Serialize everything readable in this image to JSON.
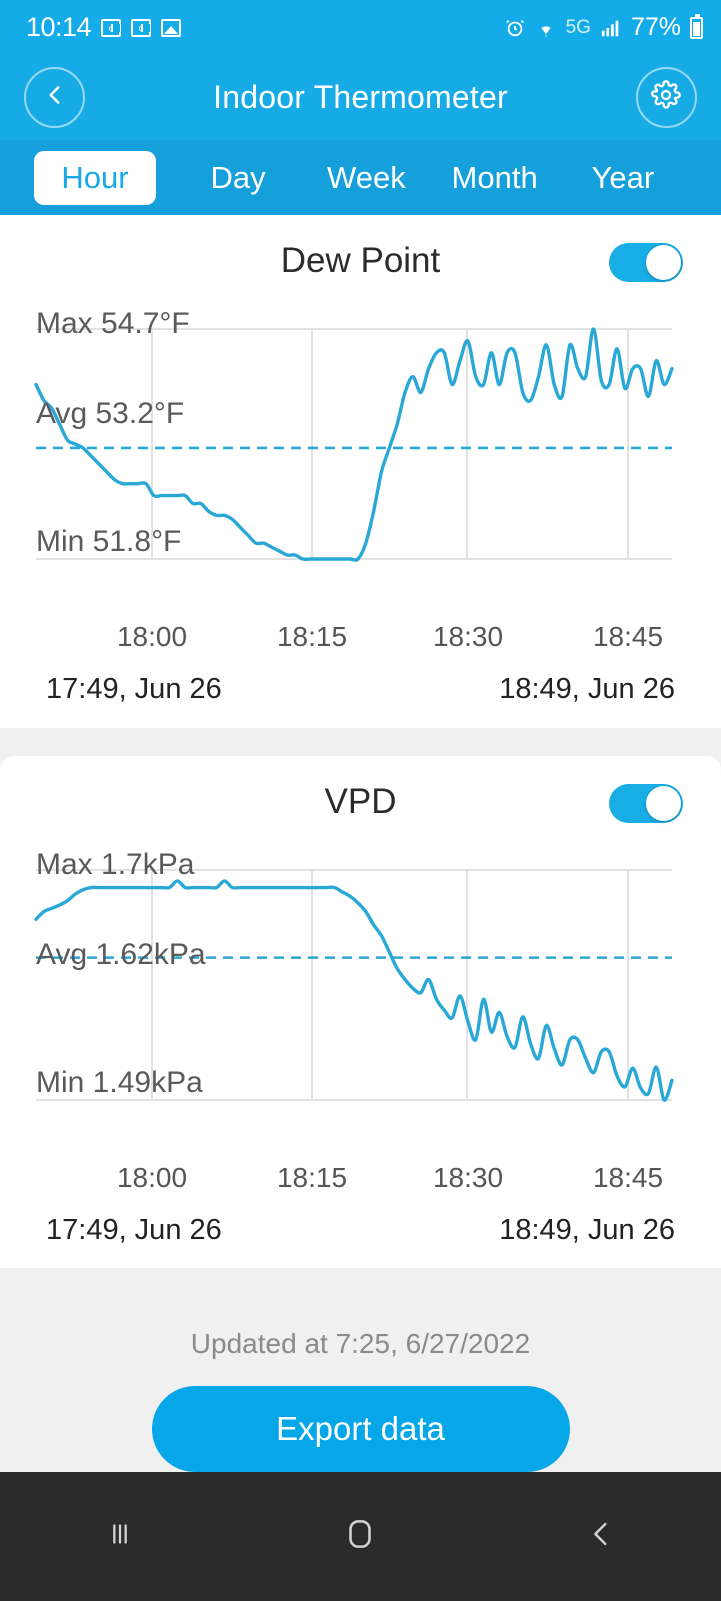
{
  "statusbar": {
    "time": "10:14",
    "network": "5G",
    "battery_pct": "77%",
    "icons": [
      "outlook-badge-icon",
      "outlook-badge-icon",
      "image-icon",
      "alarm-icon",
      "wifi-icon",
      "signal-icon",
      "battery-icon"
    ]
  },
  "appbar": {
    "title": "Indoor Thermometer",
    "back_icon": "chevron-left-icon",
    "settings_icon": "gear-icon"
  },
  "tabs": [
    {
      "label": "Hour",
      "active": true
    },
    {
      "label": "Day",
      "active": false
    },
    {
      "label": "Week",
      "active": false
    },
    {
      "label": "Month",
      "active": false
    },
    {
      "label": "Year",
      "active": false
    }
  ],
  "cards": [
    {
      "title": "Dew Point",
      "toggle_on": true,
      "max_label": "Max 54.7°F",
      "avg_label": "Avg 53.2°F",
      "min_label": "Min 51.8°F",
      "range_start": "17:49,  Jun 26",
      "range_end": "18:49,  Jun 26",
      "xticks": [
        "18:00",
        "18:15",
        "18:30",
        "18:45"
      ]
    },
    {
      "title": "VPD",
      "toggle_on": true,
      "max_label": "Max 1.7kPa",
      "avg_label": "Avg 1.62kPa",
      "min_label": "Min 1.49kPa",
      "range_start": "17:49,  Jun 26",
      "range_end": "18:49,  Jun 26",
      "xticks": [
        "18:00",
        "18:15",
        "18:30",
        "18:45"
      ]
    }
  ],
  "footer": {
    "updated": "Updated at 7:25,  6/27/2022",
    "export_label": "Export data"
  },
  "navbar": {
    "recents_icon": "recents-icon",
    "home_icon": "home-icon",
    "back_icon": "back-icon"
  },
  "colors": {
    "brand": "#17ABE6",
    "tabbar": "#159FDB",
    "line": "#29A8D8",
    "accent_button": "#06A7E8",
    "grid": "#e2e2e2",
    "page_bg": "#f0f0f0"
  },
  "chart_data": [
    {
      "type": "line",
      "title": "Dew Point",
      "ylabel": "°F",
      "xlabel": "",
      "unit": "°F",
      "max": 54.7,
      "avg": 53.2,
      "min": 51.8,
      "ylim": [
        51.8,
        54.7
      ],
      "grid": true,
      "legend": "none",
      "x_start": "17:49, Jun 26",
      "x_end": "18:49, Jun 26",
      "xtick_labels": [
        "18:00",
        "18:15",
        "18:30",
        "18:45"
      ],
      "avg_reference_line": 53.2,
      "values": [
        54.0,
        53.8,
        53.7,
        53.5,
        53.3,
        53.25,
        53.2,
        53.1,
        53.0,
        52.9,
        52.8,
        52.75,
        52.75,
        52.75,
        52.75,
        52.6,
        52.6,
        52.6,
        52.6,
        52.6,
        52.5,
        52.5,
        52.4,
        52.35,
        52.35,
        52.3,
        52.2,
        52.1,
        52.0,
        52.0,
        51.95,
        51.9,
        51.85,
        51.85,
        51.8,
        51.8,
        51.8,
        51.8,
        51.8,
        51.8,
        51.8,
        51.8,
        52.0,
        52.4,
        52.9,
        53.2,
        53.5,
        53.9,
        54.1,
        53.9,
        54.2,
        54.4,
        54.4,
        54.0,
        54.3,
        54.55,
        54.1,
        54.0,
        54.4,
        54.0,
        54.4,
        54.4,
        53.9,
        53.8,
        54.1,
        54.5,
        54.0,
        53.85,
        54.5,
        54.2,
        54.1,
        54.7,
        54.05,
        54.0,
        54.45,
        53.95,
        54.2,
        54.2,
        53.85,
        54.3,
        54.0,
        54.2
      ]
    },
    {
      "type": "line",
      "title": "VPD",
      "ylabel": "kPa",
      "xlabel": "",
      "unit": "kPa",
      "max": 1.7,
      "avg": 1.62,
      "min": 1.49,
      "ylim": [
        1.49,
        1.7
      ],
      "grid": true,
      "legend": "none",
      "x_start": "17:49, Jun 26",
      "x_end": "18:49, Jun 26",
      "xtick_labels": [
        "18:00",
        "18:15",
        "18:30",
        "18:45"
      ],
      "avg_reference_line": 1.62,
      "values": [
        1.655,
        1.662,
        1.665,
        1.668,
        1.672,
        1.678,
        1.682,
        1.684,
        1.684,
        1.684,
        1.684,
        1.684,
        1.684,
        1.684,
        1.684,
        1.684,
        1.684,
        1.684,
        1.69,
        1.684,
        1.684,
        1.684,
        1.684,
        1.684,
        1.69,
        1.684,
        1.684,
        1.684,
        1.684,
        1.684,
        1.684,
        1.684,
        1.684,
        1.684,
        1.684,
        1.684,
        1.684,
        1.684,
        1.684,
        1.68,
        1.676,
        1.67,
        1.662,
        1.65,
        1.64,
        1.625,
        1.61,
        1.6,
        1.592,
        1.588,
        1.6,
        1.582,
        1.572,
        1.565,
        1.585,
        1.562,
        1.545,
        1.582,
        1.552,
        1.57,
        1.548,
        1.538,
        1.566,
        1.541,
        1.528,
        1.558,
        1.537,
        1.522,
        1.545,
        1.545,
        1.528,
        1.515,
        1.534,
        1.534,
        1.512,
        1.502,
        1.519,
        1.501,
        1.496,
        1.52,
        1.49,
        1.508
      ]
    }
  ]
}
